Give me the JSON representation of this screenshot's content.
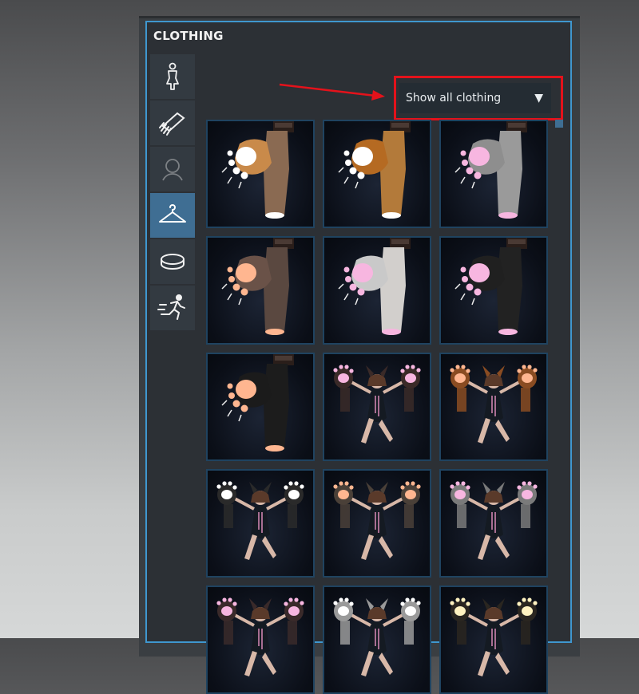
{
  "panel": {
    "title": "CLOTHING"
  },
  "sidebar": {
    "items": [
      {
        "icon": "body-figure-icon",
        "state": "normal"
      },
      {
        "icon": "comb-icon",
        "state": "normal"
      },
      {
        "icon": "head-outline-icon",
        "state": "dim"
      },
      {
        "icon": "hanger-icon",
        "state": "active"
      },
      {
        "icon": "ring-icon",
        "state": "normal"
      },
      {
        "icon": "running-figure-icon",
        "state": "normal"
      }
    ]
  },
  "filter": {
    "selected": "Show all clothing"
  },
  "colors": {
    "accent": "#3f97cf",
    "highlight": "#e4121b",
    "active_tab": "#3f6e93"
  },
  "grid": {
    "items": [
      {
        "kind": "boot",
        "fur": "#c98a4a",
        "pad": "#ffffff",
        "leg": "#8a6a52"
      },
      {
        "kind": "boot",
        "fur": "#b56a22",
        "pad": "#ffffff",
        "leg": "#b37a3a"
      },
      {
        "kind": "boot",
        "fur": "#8e8e8e",
        "pad": "#f7b6e0",
        "leg": "#9a9a9a"
      },
      {
        "kind": "boot",
        "fur": "#6a5248",
        "pad": "#ffb690",
        "leg": "#5a4840"
      },
      {
        "kind": "boot",
        "fur": "#c9c9c9",
        "pad": "#f7b6e0",
        "leg": "#d2cfcc"
      },
      {
        "kind": "boot",
        "fur": "#202020",
        "pad": "#f7b6e0",
        "leg": "#222222"
      },
      {
        "kind": "boot",
        "fur": "#1b1b1b",
        "pad": "#ffb690",
        "leg": "#1c1c1c"
      },
      {
        "kind": "figure",
        "fur": "#3a2a28",
        "pad": "#f7b6e0"
      },
      {
        "kind": "figure",
        "fur": "#8a4c22",
        "pad": "#ffb690"
      },
      {
        "kind": "figure",
        "fur": "#2a2a2a",
        "pad": "#ffffff"
      },
      {
        "kind": "figure",
        "fur": "#4a4038",
        "pad": "#ffb690"
      },
      {
        "kind": "figure",
        "fur": "#7a7a7a",
        "pad": "#f7b6e0"
      },
      {
        "kind": "figure",
        "fur": "#3a2a2a",
        "pad": "#f7b6e0"
      },
      {
        "kind": "figure",
        "fur": "#9a9a9a",
        "pad": "#ffffff"
      },
      {
        "kind": "figure",
        "fur": "#2a2620",
        "pad": "#fff2c0"
      }
    ]
  }
}
